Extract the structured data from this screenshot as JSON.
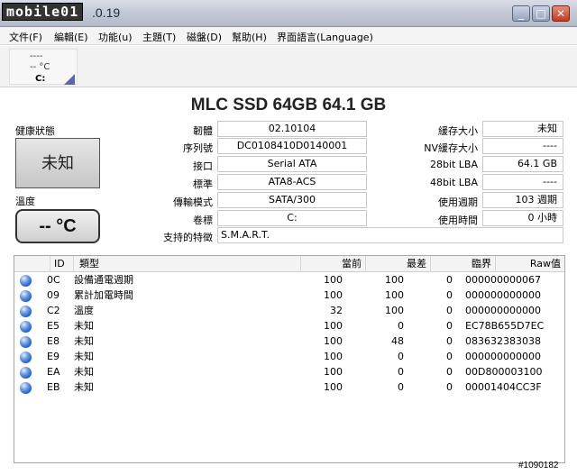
{
  "watermark": "mobile01",
  "window": {
    "title": ".0.19",
    "minimize_glyph": "_",
    "maximize_glyph": "□",
    "close_glyph": "✕"
  },
  "menu": [
    "文件(F)",
    "編輯(E)",
    "功能(u)",
    "主題(T)",
    "磁盤(D)",
    "幫助(H)",
    "界面語言(Language)"
  ],
  "drive_tile": {
    "dash": "----",
    "temp": "-- °C",
    "letter": "C:"
  },
  "drive_title": "MLC SSD 64GB  64.1 GB",
  "health": {
    "label": "健康狀態",
    "value": "未知"
  },
  "temperature": {
    "label": "溫度",
    "value": "-- °C"
  },
  "info_left": [
    {
      "label": "韌體",
      "value": "02.10104"
    },
    {
      "label": "序列號",
      "value": "DC0108410D0140001"
    },
    {
      "label": "接口",
      "value": "Serial ATA"
    },
    {
      "label": "標準",
      "value": "ATA8-ACS"
    },
    {
      "label": "傳輸模式",
      "value": "SATA/300"
    },
    {
      "label": "卷標",
      "value": "C:"
    }
  ],
  "info_right": [
    {
      "label": "緩存大小",
      "value": "未知"
    },
    {
      "label": "NV緩存大小",
      "value": "----"
    },
    {
      "label": "28bit LBA",
      "value": "64.1 GB"
    },
    {
      "label": "48bit LBA",
      "value": "----"
    },
    {
      "label": "使用週期",
      "value": "103 週期"
    },
    {
      "label": "使用時間",
      "value": "0 小時"
    }
  ],
  "features": {
    "label": "支持的特徵",
    "value": "S.M.A.R.T."
  },
  "smart_table": {
    "columns": [
      "ID",
      "類型",
      "當前",
      "最差",
      "臨界",
      "Raw值"
    ],
    "rows": [
      {
        "id": "0C",
        "type": "設備通電週期",
        "current": "100",
        "worst": "100",
        "threshold": "0",
        "raw": "000000000067"
      },
      {
        "id": "09",
        "type": "累計加電時間",
        "current": "100",
        "worst": "100",
        "threshold": "0",
        "raw": "000000000000"
      },
      {
        "id": "C2",
        "type": "溫度",
        "current": "32",
        "worst": "100",
        "threshold": "0",
        "raw": "000000000000"
      },
      {
        "id": "E5",
        "type": "未知",
        "current": "100",
        "worst": "0",
        "threshold": "0",
        "raw": "EC78B655D7EC"
      },
      {
        "id": "E8",
        "type": "未知",
        "current": "100",
        "worst": "48",
        "threshold": "0",
        "raw": "083632383038"
      },
      {
        "id": "E9",
        "type": "未知",
        "current": "100",
        "worst": "0",
        "threshold": "0",
        "raw": "000000000000"
      },
      {
        "id": "EA",
        "type": "未知",
        "current": "100",
        "worst": "0",
        "threshold": "0",
        "raw": "00D800003100"
      },
      {
        "id": "EB",
        "type": "未知",
        "current": "100",
        "worst": "0",
        "threshold": "0",
        "raw": "00001404CC3F"
      }
    ]
  },
  "footer_id": "#1090182",
  "colors": {
    "status_dot": "#1b4fb8",
    "drive_indicator": "#5a66b0"
  }
}
